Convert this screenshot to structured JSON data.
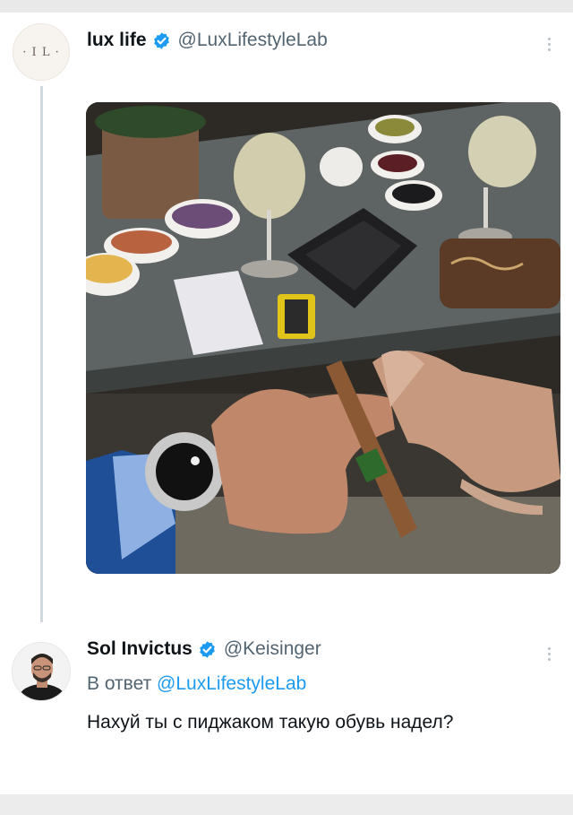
{
  "tweet": {
    "avatar_text": "· I L ·",
    "author_name": "lux life",
    "author_handle": "@LuxLifestyleLab",
    "verified_color": "#1d9bf0",
    "more_icon": "more-vertical-icon"
  },
  "reply": {
    "author_name": "Sol Invictus",
    "author_handle": "@Keisinger",
    "reply_prefix": "В ответ",
    "reply_mention": "@LuxLifestyleLab",
    "text": "Нахуй ты с пиджаком такую обувь надел?",
    "mention_color": "#1d9bf0",
    "more_icon": "more-vertical-icon"
  }
}
